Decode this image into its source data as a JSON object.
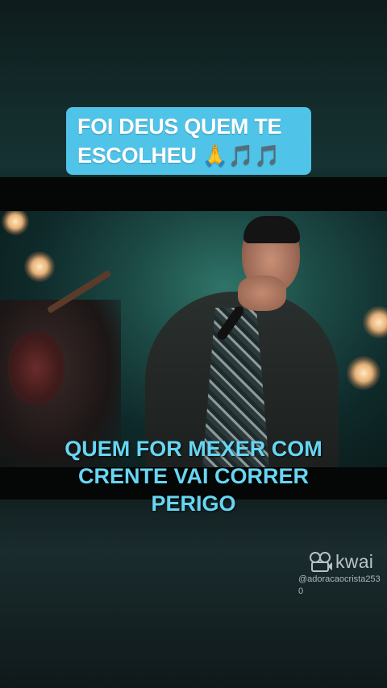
{
  "title": {
    "line1": "FOI DEUS QUEM TE",
    "line2": "ESCOLHEU",
    "emoji": "🙏🎵🎵"
  },
  "caption": {
    "line1": "QUEM FOR MEXER COM",
    "line2": "CRENTE VAI CORRER",
    "line3": "PERIGO"
  },
  "watermark": {
    "brand": "kwai",
    "handle": "@adoracaocrista2530"
  },
  "colors": {
    "title_bg": "#4fc3e8",
    "caption_text": "#67d6f2"
  },
  "icons": [
    "kwai-logo-icon"
  ]
}
